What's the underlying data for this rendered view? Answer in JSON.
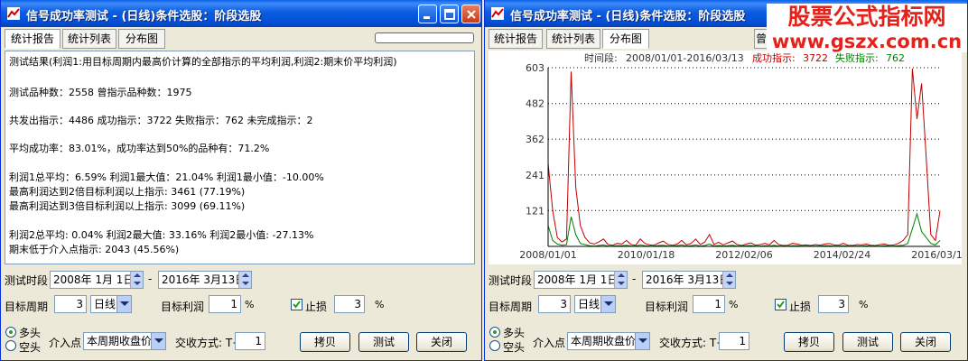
{
  "window": {
    "title": "信号成功率测试 - (日线)条件选股：阶段选股"
  },
  "tabs": [
    "统计报告",
    "统计列表",
    "分布图"
  ],
  "report": {
    "lines": [
      "测试结果(利润1:用目标周期内最高价计算的全部指示的平均利润,利润2:期末价平均利润)",
      "",
      "测试品种数：2558          曾指示品种数：1975",
      "",
      "共发出指示：4486  成功指示：3722  失败指示：762  未完成指示：2",
      "",
      "平均成功率：83.01%，成功率达到50%的品种有：71.2%",
      "",
      "利润1总平均：6.59%  利润1最大值：21.04%  利润1最小值：-10.00%",
      "最高利润达到2倍目标利润以上指示: 3461 (77.19%)",
      "最高利润达到3倍目标利润以上指示: 3099 (69.11%)",
      "",
      "利润2总平均: 0.04%  利润2最大值: 33.16%  利润2最小值: -27.13%",
      "期末低于介入点指示: 2043 (45.56%)"
    ]
  },
  "controls": {
    "test_period_label": "测试时段",
    "start_date": "2008年 1月 1日",
    "dash": "-",
    "end_date": "2016年 3月13日",
    "target_period_label": "目标周期",
    "target_period_value": "3",
    "period_type": "日线",
    "target_profit_label": "目标利润",
    "target_profit_value": "1",
    "percent": "%",
    "stop_loss_label": "止损",
    "stop_loss_checked": true,
    "stop_loss_value": "3",
    "long_label": "多头",
    "short_label": "空头",
    "entry_label": "介入点",
    "entry_value": "本周期收盘价",
    "settle_label": "交收方式: T+",
    "settle_value": "1",
    "copy_button": "拷贝",
    "test_button": "测试",
    "close_button": "关闭"
  },
  "right_tab_partial": "曾",
  "watermark": {
    "line1": "股票公式指标网",
    "line2": "www.gszx.com.cn"
  },
  "colors": {
    "success_series": "#c00000",
    "fail_series": "#008000",
    "watermark": "#e3231b"
  },
  "chart_data": {
    "type": "line",
    "header": {
      "period_label": "时间段:",
      "period_value": "2008/01/01-2016/03/13",
      "success_label": "成功指示:",
      "success_value": "3722",
      "fail_label": "失败指示:",
      "fail_value": "762"
    },
    "ylim": [
      0,
      603
    ],
    "yticks": [
      "603",
      "482",
      "362",
      "241",
      "121"
    ],
    "xticks": [
      "2008/01/01",
      "2010/01/18",
      "2012/02/06",
      "2014/02/24",
      "2016/03/13"
    ],
    "grid": true,
    "series": [
      {
        "name": "成功指示",
        "values": [
          280,
          120,
          30,
          15,
          25,
          590,
          200,
          70,
          30,
          12,
          8,
          15,
          25,
          6,
          4,
          10,
          8,
          20,
          6,
          4,
          25,
          10,
          5,
          4,
          12,
          18,
          6,
          4,
          8,
          20,
          5,
          10,
          25,
          6,
          15,
          40,
          6,
          14,
          5,
          12,
          18,
          6,
          3,
          8,
          12,
          4,
          6,
          10,
          5,
          20,
          6,
          3,
          4,
          10,
          8,
          4,
          5,
          3,
          6,
          4,
          8,
          10,
          5,
          4,
          10,
          4,
          3,
          6,
          5,
          8,
          4,
          3,
          6,
          8,
          4,
          5,
          10,
          20,
          40,
          600,
          430,
          550,
          300,
          40,
          20,
          120
        ]
      },
      {
        "name": "失败指示",
        "values": [
          70,
          20,
          8,
          4,
          6,
          100,
          40,
          10,
          6,
          2,
          1,
          3,
          5,
          1,
          1,
          2,
          2,
          4,
          1,
          1,
          5,
          2,
          1,
          1,
          3,
          4,
          1,
          1,
          2,
          5,
          1,
          2,
          5,
          1,
          3,
          8,
          1,
          3,
          1,
          2,
          4,
          1,
          1,
          2,
          3,
          1,
          1,
          2,
          1,
          4,
          1,
          1,
          1,
          2,
          2,
          1,
          1,
          1,
          1,
          1,
          2,
          2,
          1,
          1,
          2,
          1,
          1,
          1,
          1,
          2,
          1,
          1,
          1,
          2,
          1,
          1,
          2,
          4,
          10,
          60,
          110,
          50,
          30,
          10,
          5,
          20
        ]
      }
    ]
  }
}
